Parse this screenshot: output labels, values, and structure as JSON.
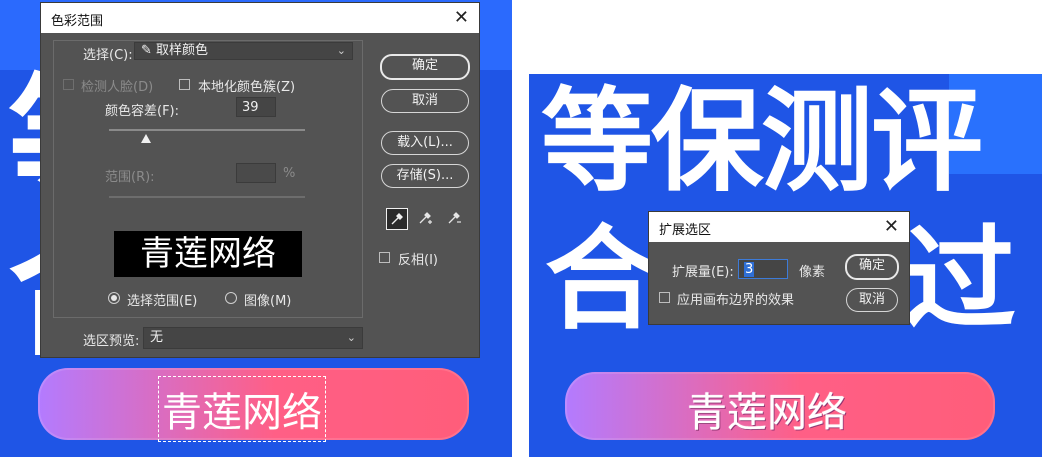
{
  "left_banner": {
    "pill_text": "青莲网络",
    "bg_glyph_top": "等",
    "bg_glyph_bottom": "合"
  },
  "right_banner": {
    "headline_top": "等保测评",
    "headline_bottom_left": "合",
    "headline_bottom_right": "过",
    "pill_text": "青莲网络"
  },
  "color_range_dialog": {
    "title": "色彩范围",
    "select_label": "选择(C):",
    "select_value": "取样颜色",
    "detect_faces_label": "检测人脸(D)",
    "localized_clusters_label": "本地化颜色簇(Z)",
    "fuzziness_label": "颜色容差(F):",
    "fuzziness_value": "39",
    "fuzziness_fraction": 0.19,
    "range_label": "范围(R):",
    "range_unit": "%",
    "preview_text": "青莲网络",
    "radio_selection_label": "选择范围(E)",
    "radio_image_label": "图像(M)",
    "ok_label": "确定",
    "cancel_label": "取消",
    "load_label": "载入(L)...",
    "save_label": "存储(S)...",
    "invert_label": "反相(I)",
    "selection_preview_label": "选区预览:",
    "selection_preview_value": "无"
  },
  "expand_dialog": {
    "title": "扩展选区",
    "expand_by_label": "扩展量(E):",
    "expand_by_value": "3",
    "unit_label": "像素",
    "apply_canvas_label": "应用画布边界的效果",
    "ok_label": "确定",
    "cancel_label": "取消"
  }
}
